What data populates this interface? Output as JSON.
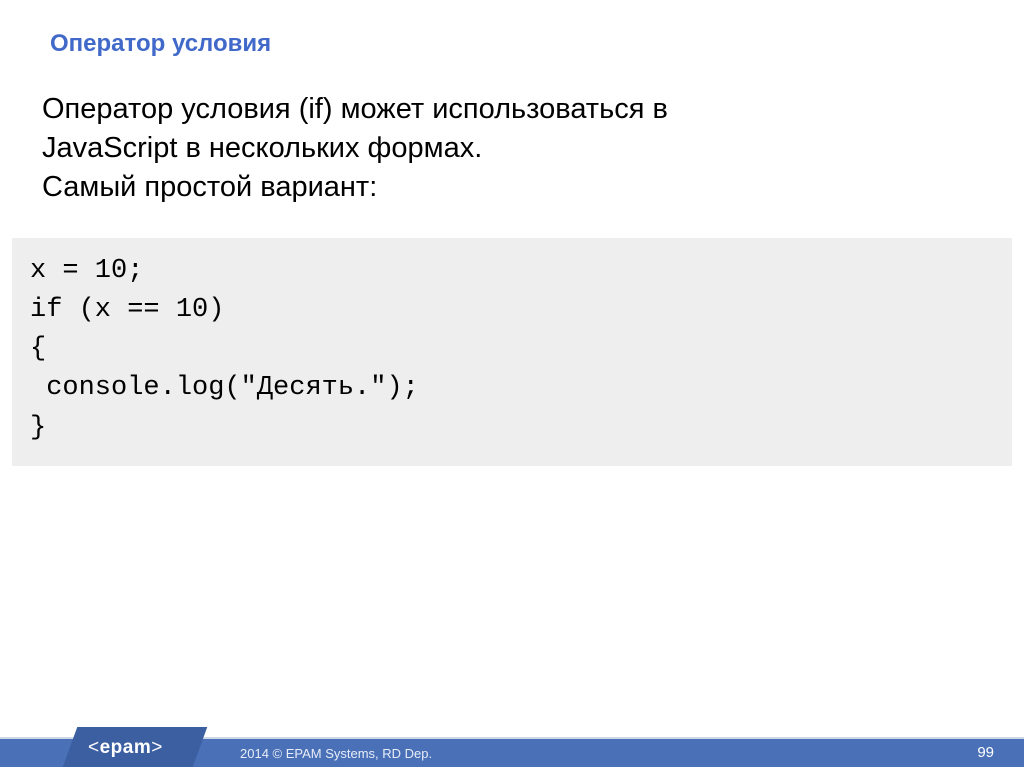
{
  "slide": {
    "heading": "Оператор условия",
    "body_line1": "Оператор условия (if) может использоваться в",
    "body_line2": "JavaScript в нескольких формах.",
    "body_line3": "Самый простой вариант:",
    "code": "x = 10;\nif (x == 10)\n{\n console.log(\"Десять.\");\n}"
  },
  "footer": {
    "logo": "<EPAM>",
    "copyright": "2014 © EPAM Systems, RD Dep.",
    "page_number": "99"
  }
}
